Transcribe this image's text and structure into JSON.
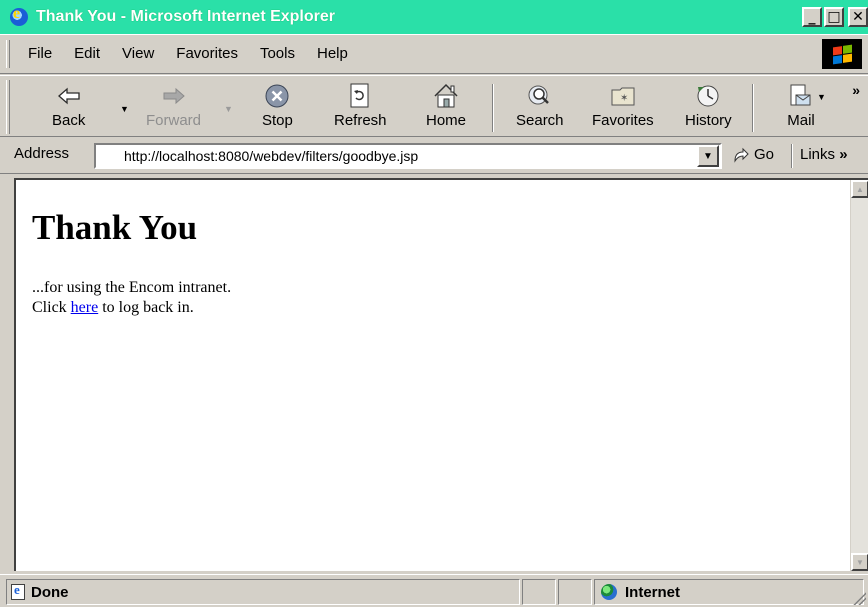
{
  "window": {
    "title": "Thank You - Microsoft Internet Explorer",
    "minimize_glyph": "_",
    "maximize_glyph": "□",
    "close_glyph": "✕"
  },
  "menu": [
    "File",
    "Edit",
    "View",
    "Favorites",
    "Tools",
    "Help"
  ],
  "toolbar": {
    "back": "Back",
    "forward": "Forward",
    "stop": "Stop",
    "refresh": "Refresh",
    "home": "Home",
    "search": "Search",
    "favorites": "Favorites",
    "history": "History",
    "mail": "Mail",
    "more": "»"
  },
  "address": {
    "label": "Address",
    "url": "http://localhost:8080/webdev/filters/goodbye.jsp",
    "go": "Go",
    "links": "Links",
    "links_more": "»"
  },
  "page": {
    "heading": "Thank You",
    "line1": "...for using the Encom intranet.",
    "line2_before": "Click ",
    "link": "here",
    "line2_after": " to log back in."
  },
  "status": {
    "text": "Done",
    "zone": "Internet"
  },
  "colors": {
    "title_bar": "#2ae0a8",
    "chrome": "#d4d0c8",
    "link": "#0000ee"
  }
}
